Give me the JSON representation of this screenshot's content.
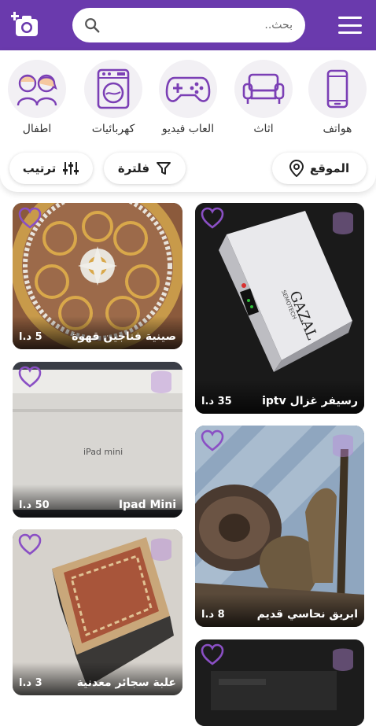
{
  "header": {
    "search_placeholder": "بحث.."
  },
  "categories": [
    {
      "label": "هواتف",
      "icon": "phone-icon"
    },
    {
      "label": "اثاث",
      "icon": "sofa-icon"
    },
    {
      "label": "العاب فيديو",
      "icon": "gamepad-icon"
    },
    {
      "label": "كهربائيات",
      "icon": "washing-machine-icon"
    },
    {
      "label": "اطفال",
      "icon": "kids-icon"
    }
  ],
  "filters": {
    "location_label": "الموقع",
    "filter_label": "فلترة",
    "sort_label": "ترتيب"
  },
  "listings": [
    {
      "title": "صينية فناجين قهوة",
      "price": "5 د.ا"
    },
    {
      "title": "رسيفر غزال iptv",
      "price": "35 د.ا"
    },
    {
      "title": "Ipad Mini",
      "price": "50 د.ا"
    },
    {
      "title": "ابريق نحاسي قديم",
      "price": "8 د.ا"
    },
    {
      "title": "علبة سجائر معدنية",
      "price": "3 د.ا"
    },
    {
      "title": "",
      "price": ""
    }
  ],
  "images": {
    "receiver_brand": "GAZAL",
    "receiver_sub": "SEMOTECH",
    "ipad_text": "iPad mini"
  },
  "colors": {
    "primary": "#6a3aad",
    "icon_purple": "#7b3fb5"
  }
}
